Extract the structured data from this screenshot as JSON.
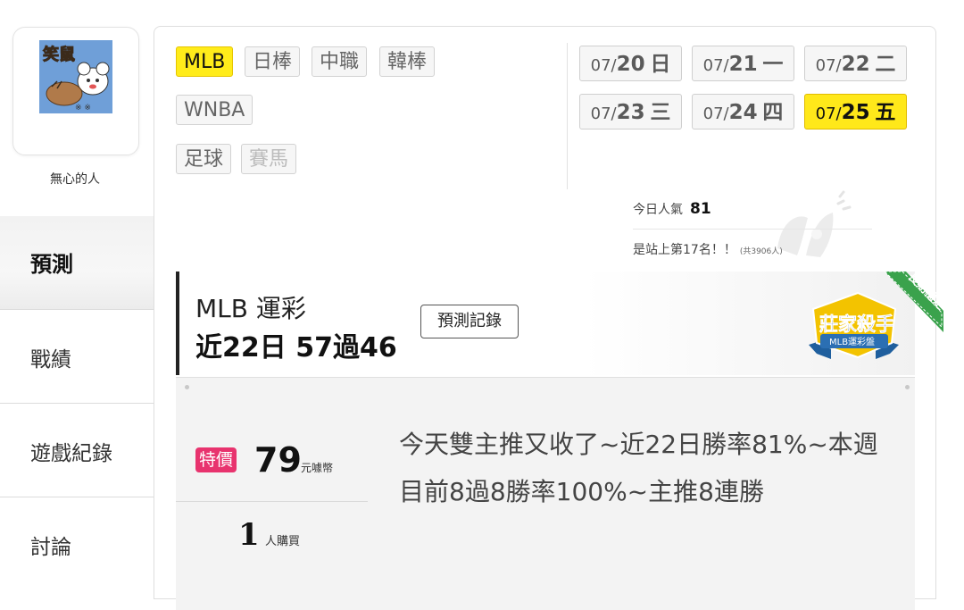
{
  "user": {
    "avatar_text": "笑鼠",
    "name": "無心的人"
  },
  "nav": [
    {
      "label": "預測",
      "active": true
    },
    {
      "label": "戰績",
      "active": false
    },
    {
      "label": "遊戲紀錄",
      "active": false
    },
    {
      "label": "討論",
      "active": false
    }
  ],
  "league_tabs": [
    {
      "label": "MLB",
      "state": "active"
    },
    {
      "label": "日棒",
      "state": "normal"
    },
    {
      "label": "中職",
      "state": "normal"
    },
    {
      "label": "韓棒",
      "state": "normal"
    },
    {
      "label": "WNBA",
      "state": "normal"
    },
    {
      "label": "足球",
      "state": "normal"
    },
    {
      "label": "賽馬",
      "state": "disabled"
    }
  ],
  "dates": [
    {
      "month": "07/",
      "day": "20",
      "weekday": "日",
      "active": false
    },
    {
      "month": "07/",
      "day": "21",
      "weekday": "一",
      "active": false
    },
    {
      "month": "07/",
      "day": "22",
      "weekday": "二",
      "active": false
    },
    {
      "month": "07/",
      "day": "23",
      "weekday": "三",
      "active": false
    },
    {
      "month": "07/",
      "day": "24",
      "weekday": "四",
      "active": false
    },
    {
      "month": "07/",
      "day": "25",
      "weekday": "五",
      "active": true
    }
  ],
  "popularity": {
    "label": "今日人氣",
    "value": "81",
    "rank_text": "是站上第17名！！",
    "total_text": "(共3906人)"
  },
  "banner": {
    "title": "MLB 運彩",
    "stat": "近22日 57過46",
    "record_button": "預測記錄",
    "badge_title": "莊家殺手",
    "badge_sub": "MLB運彩盤",
    "ribbon": "長期穩定"
  },
  "offer": {
    "sale_label": "特價",
    "price": "79",
    "price_unit": "元噱幣",
    "buyers": "1",
    "buyers_unit": "人購買",
    "description": "今天雙主推又收了~近22日勝率81%~本週目前8過8勝率100%~主推8連勝"
  },
  "colors": {
    "highlight": "#ffec1a",
    "sale": "#e8336e",
    "badge_gold": "#f3c300",
    "badge_blue": "#2b6fb3"
  }
}
